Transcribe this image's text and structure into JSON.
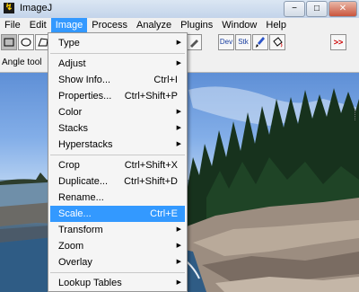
{
  "window": {
    "title": "ImageJ",
    "min": "−",
    "max": "□",
    "close": "✕"
  },
  "menubar": [
    "File",
    "Edit",
    "Image",
    "Process",
    "Analyze",
    "Plugins",
    "Window",
    "Help"
  ],
  "toolbar": {
    "dev_label": "Dev",
    "stk_label": "Stk",
    "more_label": ">>"
  },
  "status": {
    "text": "Angle tool"
  },
  "image_menu": {
    "items": [
      {
        "label": "Type",
        "shortcut": "",
        "submenu": true
      },
      {
        "label": "Adjust",
        "shortcut": "",
        "submenu": true
      },
      {
        "label": "Show Info...",
        "shortcut": "Ctrl+I",
        "submenu": false
      },
      {
        "label": "Properties...",
        "shortcut": "Ctrl+Shift+P",
        "submenu": false
      },
      {
        "label": "Color",
        "shortcut": "",
        "submenu": true
      },
      {
        "label": "Stacks",
        "shortcut": "",
        "submenu": true
      },
      {
        "label": "Hyperstacks",
        "shortcut": "",
        "submenu": true
      },
      {
        "label": "Crop",
        "shortcut": "Ctrl+Shift+X",
        "submenu": false
      },
      {
        "label": "Duplicate...",
        "shortcut": "Ctrl+Shift+D",
        "submenu": false
      },
      {
        "label": "Rename...",
        "shortcut": "",
        "submenu": false
      },
      {
        "label": "Scale...",
        "shortcut": "Ctrl+E",
        "submenu": false
      },
      {
        "label": "Transform",
        "shortcut": "",
        "submenu": true
      },
      {
        "label": "Zoom",
        "shortcut": "",
        "submenu": true
      },
      {
        "label": "Overlay",
        "shortcut": "",
        "submenu": true
      },
      {
        "label": "Lookup Tables",
        "shortcut": "",
        "submenu": true
      }
    ],
    "highlighted": "Scale..."
  },
  "colors": {
    "highlight": "#3399ff",
    "menu_bg": "#f5f5f5"
  }
}
